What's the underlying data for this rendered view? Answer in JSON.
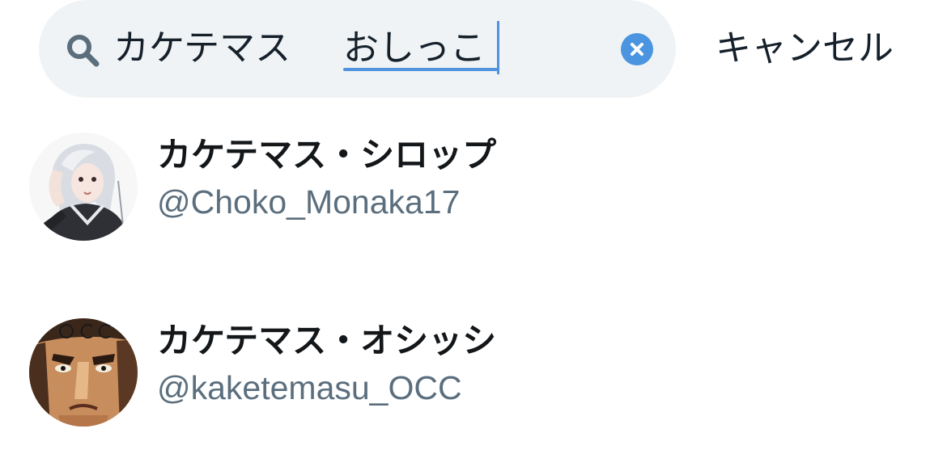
{
  "search": {
    "query_confirmed": "カケテマス",
    "query_composing": "おしっこ",
    "clear_label": "×",
    "cancel_label": "キャンセル"
  },
  "results": [
    {
      "display_name": "カケテマス・シロップ",
      "handle": "@Choko_Monaka17"
    },
    {
      "display_name": "カケテマス・オシッシ",
      "handle": "@kaketemasu_OCC"
    }
  ],
  "colors": {
    "search_bg": "#eff3f5",
    "accent": "#4b95e0",
    "text_primary": "#14171a",
    "text_secondary": "#5b6e7d"
  }
}
